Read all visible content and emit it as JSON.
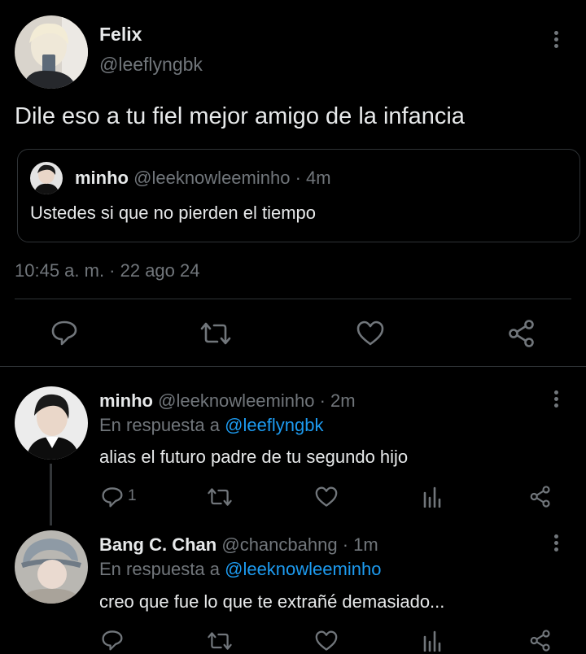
{
  "main_tweet": {
    "author_name": "Felix",
    "author_handle": "@leeflyngbk",
    "text": "Dile eso a tu fiel mejor amigo de la infancia",
    "timestamp": "10:45 a. m. · 22 ago 24",
    "quote": {
      "author_name": "minho",
      "author_handle_time": "@leeknowleeminho · 4m",
      "text": "Ustedes si que no pierden el tiempo"
    },
    "actions": [
      "reply-icon",
      "retweet-icon",
      "like-icon",
      "share-icon"
    ]
  },
  "replies": [
    {
      "author_name": "minho",
      "author_handle_time": "@leeknowleeminho · 2m",
      "replying_prefix": "En respuesta a",
      "replying_to": "@leeflyngbk",
      "text": "alias el futuro padre de tu segundo hijo",
      "reply_count": "1",
      "actions": [
        "reply-icon",
        "retweet-icon",
        "like-icon",
        "views-icon",
        "share-icon"
      ]
    },
    {
      "author_name": "Bang C. Chan",
      "author_handle_time": "@chancbahng · 1m",
      "replying_prefix": "En respuesta a",
      "replying_to": "@leeknowleeminho",
      "text": "creo que fue lo que te extrañé demasiado...",
      "reply_count": "",
      "actions": [
        "reply-icon",
        "retweet-icon",
        "like-icon",
        "views-icon",
        "share-icon"
      ]
    }
  ],
  "colors": {
    "background": "#000000",
    "text": "#e7e9ea",
    "secondary": "#71767b",
    "link": "#1d9bf0",
    "border": "#2f3336"
  }
}
